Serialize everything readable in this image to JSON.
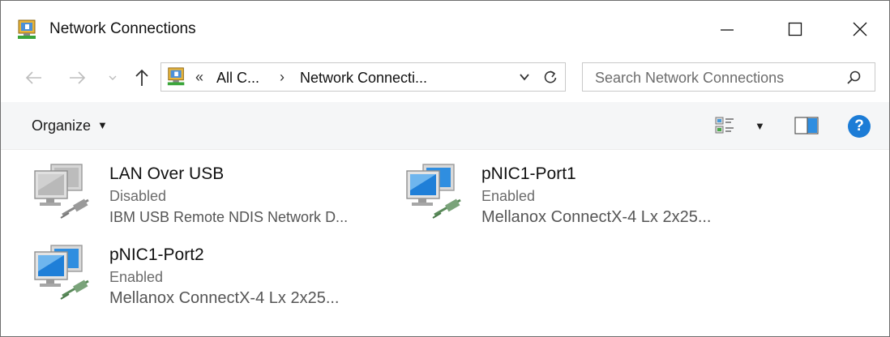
{
  "window": {
    "title": "Network Connections",
    "icon": "network-connections-icon"
  },
  "address": {
    "overflow": "«",
    "crumbs": [
      "All C...",
      "Network Connecti..."
    ],
    "separator": "›"
  },
  "search": {
    "placeholder": "Search Network Connections"
  },
  "toolbar": {
    "organize_label": "Organize"
  },
  "items": [
    {
      "name": "LAN Over USB",
      "status": "Disabled",
      "device": "IBM USB Remote NDIS Network D...",
      "state": "disabled"
    },
    {
      "name": "pNIC1-Port1",
      "status": "Enabled",
      "device": "Mellanox ConnectX-4 Lx 2x25...",
      "state": "enabled"
    },
    {
      "name": "pNIC1-Port2",
      "status": "Enabled",
      "device": "Mellanox ConnectX-4 Lx 2x25...",
      "state": "enabled"
    }
  ],
  "colors": {
    "accent": "#1c7cd6",
    "monitor_enabled": "#2f8ee0",
    "monitor_disabled": "#b8b8b8"
  }
}
